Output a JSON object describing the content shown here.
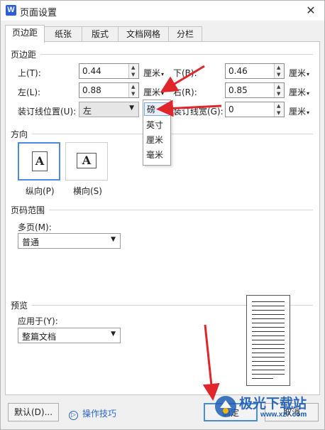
{
  "window": {
    "title": "页面设置",
    "app_icon_letter": "W",
    "close": "✕"
  },
  "tabs": [
    {
      "label": "页边距",
      "active": true
    },
    {
      "label": "纸张",
      "active": false
    },
    {
      "label": "版式",
      "active": false
    },
    {
      "label": "文档网格",
      "active": false
    },
    {
      "label": "分栏",
      "active": false
    }
  ],
  "margins": {
    "section": "页边距",
    "top": {
      "label": "上(T):",
      "value": "0.44",
      "unit": "厘米"
    },
    "bottom": {
      "label": "下(B):",
      "value": "0.46",
      "unit": "厘米"
    },
    "left": {
      "label": "左(L):",
      "value": "0.88",
      "unit": "厘米"
    },
    "right": {
      "label": "右(R):",
      "value": "0.85",
      "unit": "厘米"
    },
    "gutter_pos": {
      "label": "装订线位置(U):",
      "value": "左"
    },
    "gutter_width": {
      "label": "装订线宽(G):",
      "value": "0",
      "unit": "厘米"
    }
  },
  "unit_menu": {
    "items": [
      "磅",
      "英寸",
      "厘米",
      "毫米"
    ],
    "selected": "磅"
  },
  "orientation": {
    "section": "方向",
    "portrait": {
      "label": "纵向(P)",
      "glyph": "A",
      "selected": true
    },
    "landscape": {
      "label": "横向(S)",
      "glyph": "A"
    }
  },
  "page_range": {
    "section": "页码范围",
    "multi_label": "多页(M):",
    "multi_value": "普通"
  },
  "preview": {
    "section": "预览",
    "apply_label": "应用于(Y):",
    "apply_value": "整篇文档"
  },
  "buttons": {
    "default": "默认(D)...",
    "tips": "操作技巧",
    "ok": "确定",
    "cancel": "取消"
  },
  "watermark": {
    "text": "极光下载站",
    "url": "www.xz7.com"
  },
  "colors": {
    "accent": "#4a8de0",
    "arrow": "#e0262b",
    "link": "#2a66c9"
  }
}
